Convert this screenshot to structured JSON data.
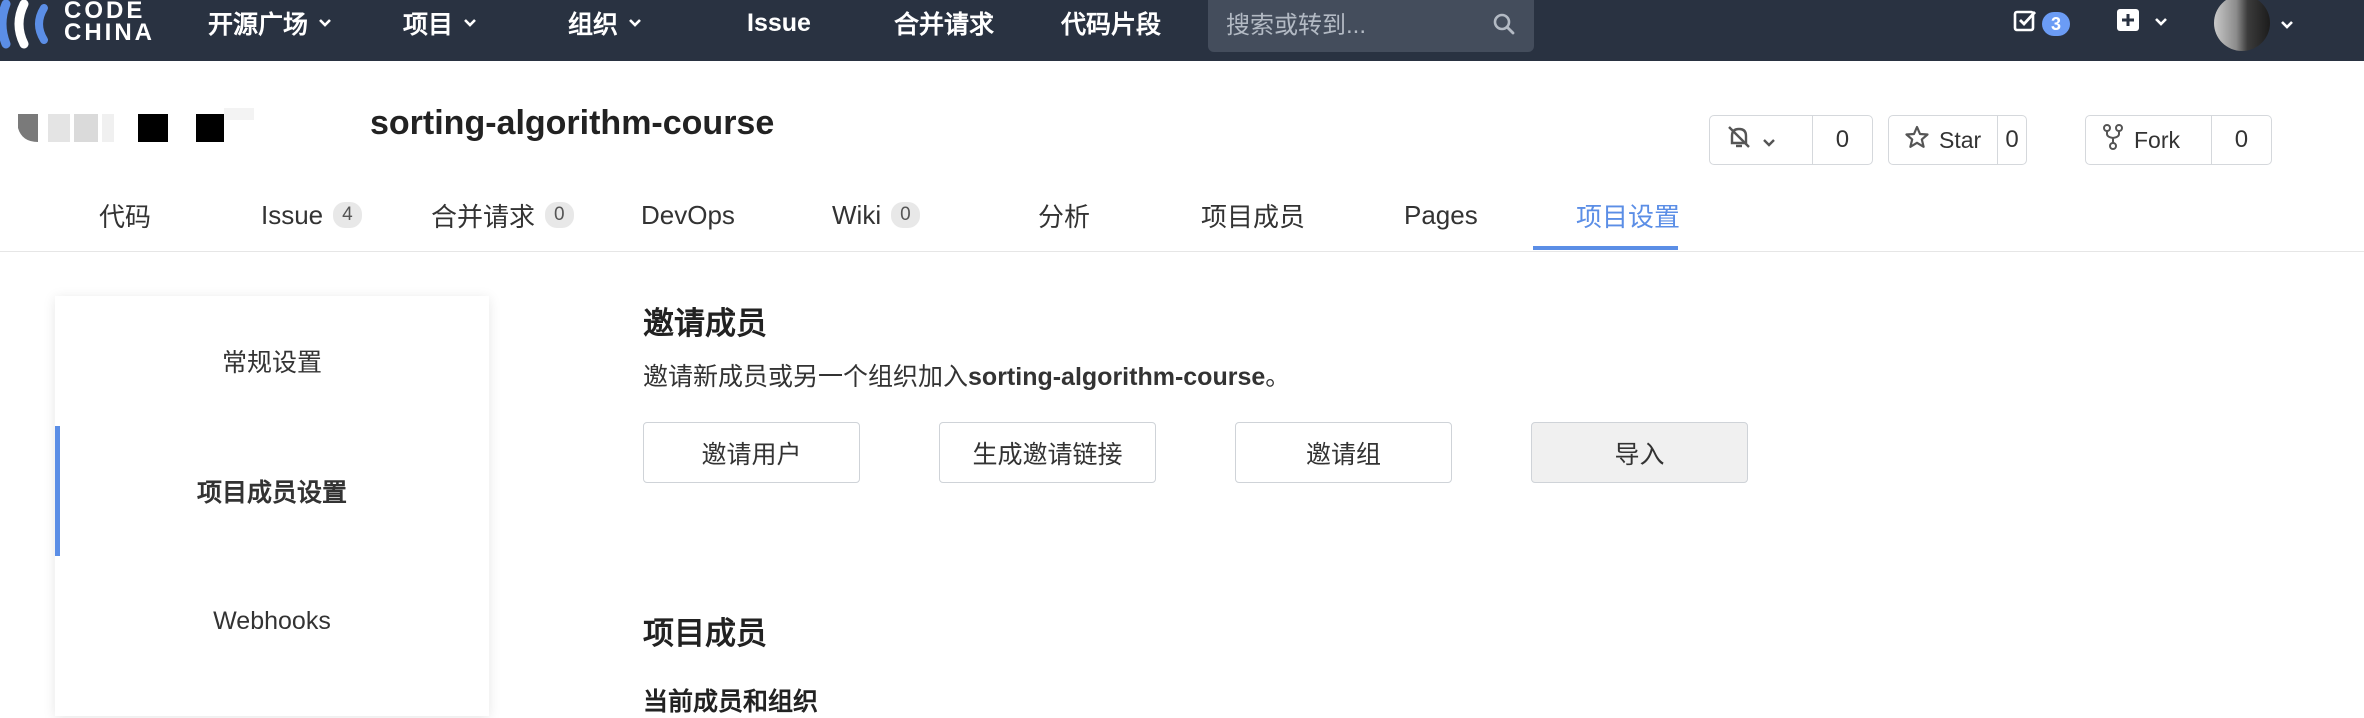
{
  "colors": {
    "nav_bg": "#293241",
    "accent": "#5b8ee6",
    "badge": "#6b9cf5"
  },
  "logo": {
    "line1": "CODE",
    "line2": "CHINA"
  },
  "nav": {
    "items": [
      "开源广场",
      "项目",
      "组织",
      "Issue",
      "合并请求",
      "代码片段"
    ],
    "search_placeholder": "搜索或转到...",
    "todo_count": "3"
  },
  "repo": {
    "name": "sorting-algorithm-course",
    "watch_count": "0",
    "star_label": "Star",
    "star_count": "0",
    "fork_label": "Fork",
    "fork_count": "0"
  },
  "tabs": [
    {
      "label": "代码"
    },
    {
      "label": "Issue",
      "count": "4"
    },
    {
      "label": "合并请求",
      "count": "0"
    },
    {
      "label": "DevOps"
    },
    {
      "label": "Wiki",
      "count": "0"
    },
    {
      "label": "分析"
    },
    {
      "label": "项目成员"
    },
    {
      "label": "Pages"
    },
    {
      "label": "项目设置",
      "active": true
    }
  ],
  "sidebar": {
    "items": [
      "常规设置",
      "项目成员设置",
      "Webhooks"
    ],
    "active_index": 1
  },
  "invite": {
    "title": "邀请成员",
    "desc_prefix": "邀请新成员或另一个组织加入",
    "desc_repo": "sorting-algorithm-course",
    "desc_suffix": "。",
    "buttons": [
      "邀请用户",
      "生成邀请链接",
      "邀请组",
      "导入"
    ]
  },
  "members": {
    "title": "项目成员",
    "subtitle": "当前成员和组织"
  }
}
